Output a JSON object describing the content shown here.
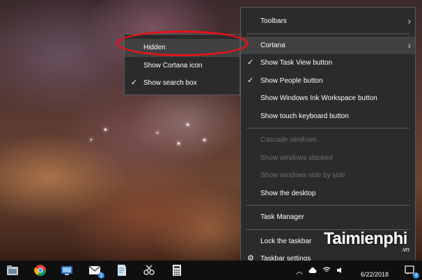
{
  "main_menu": {
    "items": [
      {
        "label": "Toolbars",
        "submenu": true
      },
      {
        "label": "Cortana",
        "submenu": true,
        "selected": true
      },
      {
        "label": "Show Task View button",
        "checked": true
      },
      {
        "label": "Show People button",
        "checked": true
      },
      {
        "label": "Show Windows Ink Workspace button"
      },
      {
        "label": "Show touch keyboard button"
      },
      {
        "label": "Cascade windows",
        "disabled": true
      },
      {
        "label": "Show windows stacked",
        "disabled": true
      },
      {
        "label": "Show windows side by side",
        "disabled": true
      },
      {
        "label": "Show the desktop"
      },
      {
        "label": "Task Manager"
      },
      {
        "label": "Lock the taskbar"
      },
      {
        "label": "Taskbar settings",
        "icon": "gear-icon"
      }
    ]
  },
  "cortana_submenu": {
    "items": [
      {
        "label": "Hidden",
        "selected": true
      },
      {
        "label": "Show Cortana icon"
      },
      {
        "label": "Show search box",
        "checked": true
      }
    ]
  },
  "check_glyph": "✓",
  "arrow_glyph": "›",
  "gear_glyph": "⚙",
  "taskbar": {
    "badges": {
      "mail": "1",
      "notifications": "4"
    },
    "clock_date": "6/22/2018"
  },
  "watermark": {
    "brand": "Taimienphi",
    "suffix": ".vn"
  },
  "colors": {
    "highlight_ring": "#e0141a",
    "menu_bg": "#2b2b2b",
    "taskbar_bg": "#0f0f10"
  }
}
